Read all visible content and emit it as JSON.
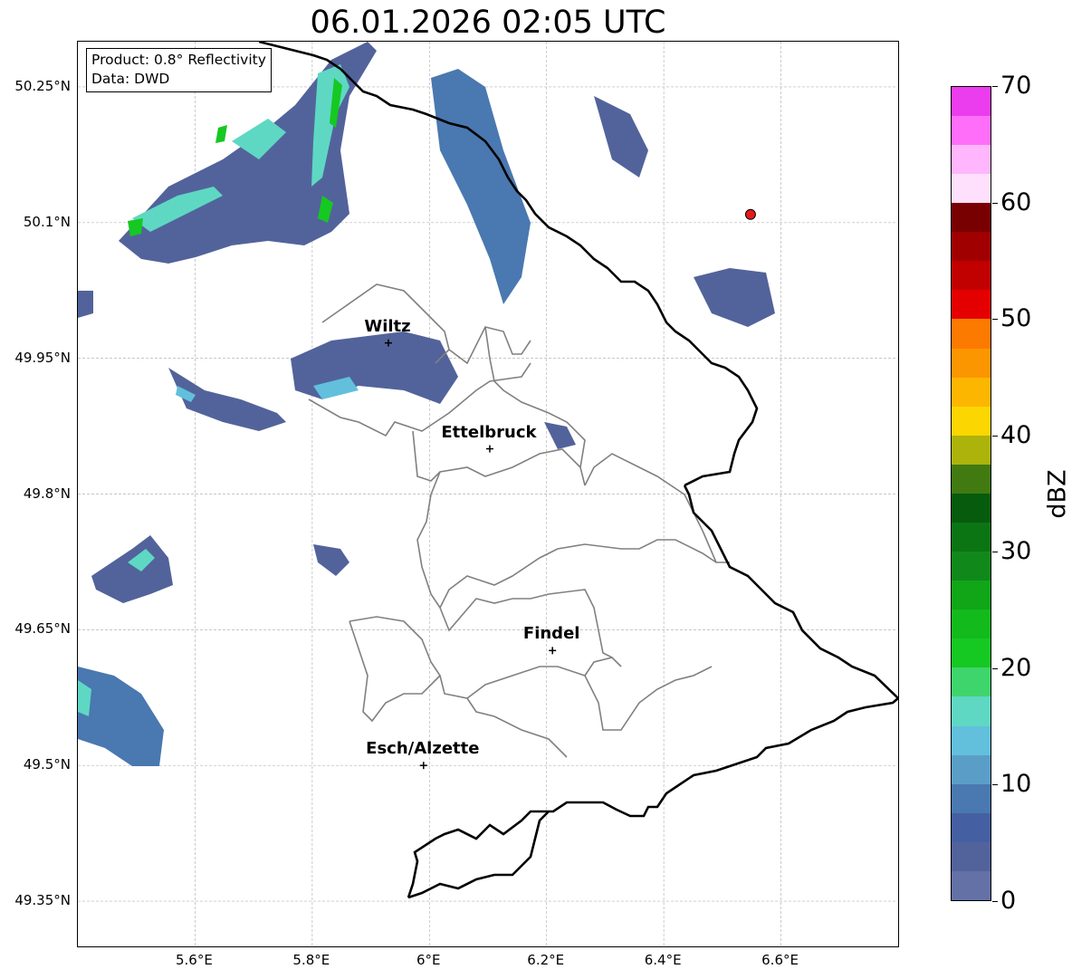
{
  "title": "06.01.2026 02:05 UTC",
  "info_box": {
    "product": "Product: 0.8° Reflectivity",
    "data": "Data: DWD"
  },
  "map": {
    "lon_range": [
      5.4,
      6.8
    ],
    "lat_range": [
      49.3,
      50.3
    ],
    "lat_ticks": [
      {
        "value": 50.25,
        "label": "50.25°N"
      },
      {
        "value": 50.1,
        "label": "50.1°N"
      },
      {
        "value": 49.95,
        "label": "49.95°N"
      },
      {
        "value": 49.8,
        "label": "49.8°N"
      },
      {
        "value": 49.65,
        "label": "49.65°N"
      },
      {
        "value": 49.5,
        "label": "49.5°N"
      },
      {
        "value": 49.35,
        "label": "49.35°N"
      }
    ],
    "lon_ticks": [
      {
        "value": 5.6,
        "label": "5.6°E"
      },
      {
        "value": 5.8,
        "label": "5.8°E"
      },
      {
        "value": 6.0,
        "label": "6°E"
      },
      {
        "value": 6.2,
        "label": "6.2°E"
      },
      {
        "value": 6.4,
        "label": "6.4°E"
      },
      {
        "value": 6.6,
        "label": "6.6°E"
      }
    ],
    "cities": [
      {
        "name": "Wiltz",
        "lon": 5.93,
        "lat": 49.967
      },
      {
        "name": "Ettelbruck",
        "lon": 6.103,
        "lat": 49.85
      },
      {
        "name": "Findel",
        "lon": 6.21,
        "lat": 49.627
      },
      {
        "name": "Esch/Alzette",
        "lon": 5.99,
        "lat": 49.5
      }
    ],
    "radar_site": {
      "lon": 6.548,
      "lat": 50.109,
      "color": "#e31a1c"
    },
    "colors": {
      "border": "#000000",
      "cantons": "#808080",
      "grid": "#b5b5b5"
    }
  },
  "colorbar": {
    "unit": "dBZ",
    "min": 0,
    "max": 70,
    "ticks": [
      "0",
      "10",
      "20",
      "30",
      "40",
      "50",
      "60",
      "70"
    ],
    "colors": [
      "#6471a6",
      "#52639b",
      "#4460a2",
      "#4a78b0",
      "#5a9ec8",
      "#62c0dc",
      "#5ed8c3",
      "#3fd56d",
      "#16c822",
      "#12ba1c",
      "#10a617",
      "#10891a",
      "#0b7514",
      "#075b0d",
      "#407a10",
      "#acb30b",
      "#fcd600",
      "#fcb600",
      "#fc9600",
      "#fc7a00",
      "#e40000",
      "#c10000",
      "#a00000",
      "#780000",
      "#ffe0fc",
      "#ffb6fc",
      "#ff6ef9",
      "#eb3ced"
    ]
  }
}
